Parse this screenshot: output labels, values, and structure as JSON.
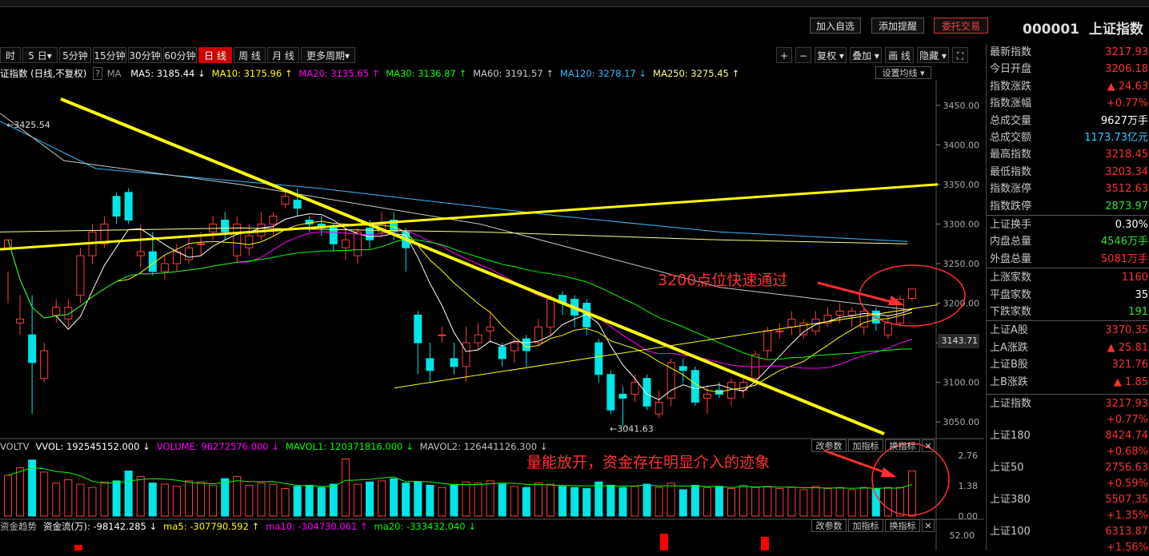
{
  "toolbar": {
    "buttons": [
      "加入自选",
      "添加提醒",
      "委托交易"
    ],
    "code": "000001",
    "name": "上证指数"
  },
  "periods": [
    "时",
    "5 日▾",
    "5分钟",
    "15分钟",
    "30分钟",
    "60分钟",
    "日 线",
    "周 线",
    "月 线",
    "更多周期▾"
  ],
  "active_period": "日 线",
  "tools": [
    "+",
    "−",
    "复权 ▾",
    "叠加 ▾",
    "画 线",
    "隐藏 ▾",
    "⛶"
  ],
  "ma_line": {
    "label": "证指数 (日线,不复权)",
    "help": "?",
    "ma": "MA",
    "items": [
      {
        "text": "MA5: 3185.44 ↓",
        "color": "#ffffff"
      },
      {
        "text": "MA10: 3175.96 ↑",
        "color": "#ffff00"
      },
      {
        "text": "MA20: 3135.65 ↑",
        "color": "#ff00ff"
      },
      {
        "text": "MA30: 3136.87 ↑",
        "color": "#00ff00"
      },
      {
        "text": "MA60: 3191.57 ↑",
        "color": "#c8c8c8"
      },
      {
        "text": "MA120: 3278.17 ↓",
        "color": "#33bbff"
      },
      {
        "text": "MA250: 3275.45 ↑",
        "color": "#ffff88"
      }
    ],
    "settings": "设置均线 ▾"
  },
  "vol_line": {
    "items": [
      {
        "text": "VOLTV",
        "color": "#c0c0c0"
      },
      {
        "text": "VVOL: 192545152.000 ↓",
        "color": "#ffffff"
      },
      {
        "text": "VOLUME: 96272576.000 ↓",
        "color": "#ff00ff"
      },
      {
        "text": "MAVOL1: 120371816.000 ↓",
        "color": "#00ff00"
      },
      {
        "text": "MAVOL2: 126441126.300 ↓",
        "color": "#c0c0c0"
      }
    ]
  },
  "flow_line": {
    "items": [
      {
        "text": "资金趋势",
        "color": "#c0c0c0"
      },
      {
        "text": "资金流(万): -98142.285 ↓",
        "color": "#ffffff"
      },
      {
        "text": "ma5: -307790.592 ↑",
        "color": "#ffff00"
      },
      {
        "text": "ma10: -304730.061 ↑",
        "color": "#ff00ff"
      },
      {
        "text": "ma20: -333432.040 ↓",
        "color": "#00ff00"
      }
    ]
  },
  "indicator_buttons": [
    "改参数",
    "加指标",
    "换指标",
    "✕"
  ],
  "side_rows": [
    {
      "k": "最新指数",
      "v": "3217.93",
      "c": "#ff3030"
    },
    {
      "k": "今日开盘",
      "v": "3206.18",
      "c": "#ff3030"
    },
    {
      "k": "指数涨跌",
      "v": "▲ 24.63",
      "c": "#ff3030"
    },
    {
      "k": "指数涨幅",
      "v": "+0.77%",
      "c": "#ff3030"
    },
    {
      "k": "总成交量",
      "v": "9627万手",
      "c": "#ffffff"
    },
    {
      "k": "总成交额",
      "v": "1173.73亿元",
      "c": "#33ccff"
    },
    {
      "k": "最高指数",
      "v": "3218.45",
      "c": "#ff3030"
    },
    {
      "k": "最低指数",
      "v": "3203.34",
      "c": "#ff3030"
    },
    {
      "k": "指数涨停",
      "v": "3512.63",
      "c": "#ff3030"
    },
    {
      "k": "指数跌停",
      "v": "2873.97",
      "c": "#33dd33"
    },
    {
      "k": "上证换手",
      "v": "0.30%",
      "c": "#ffffff"
    },
    {
      "k": "内盘总量",
      "v": "4546万手",
      "c": "#33dd33"
    },
    {
      "k": "外盘总量",
      "v": "5081万手",
      "c": "#ff3030"
    },
    {
      "k": "上涨家数",
      "v": "1160",
      "c": "#ff3030"
    },
    {
      "k": "平盘家数",
      "v": "35",
      "c": "#ffffff"
    },
    {
      "k": "下跌家数",
      "v": "191",
      "c": "#33dd33"
    },
    {
      "k": "上证A股",
      "v": "3370.35",
      "c": "#ff3030"
    },
    {
      "k": "上A涨跌",
      "v": "▲ 25.81",
      "c": "#ff3030"
    },
    {
      "k": "上证B股",
      "v": "321.76",
      "c": "#ff3030"
    },
    {
      "k": "上B涨跌",
      "v": "▲ 1.85",
      "c": "#ff3030"
    }
  ],
  "side_indices": [
    {
      "k": "上证指数",
      "v": "3217.93",
      "p": "+0.77%"
    },
    {
      "k": "上证180",
      "v": "8424.74",
      "p": "+0.68%"
    },
    {
      "k": "上证50",
      "v": "2756.63",
      "p": "+0.59%"
    },
    {
      "k": "上证380",
      "v": "5507.35",
      "p": "+1.35%"
    },
    {
      "k": "上证100",
      "v": "6313.87",
      "p": "+1.56%"
    }
  ],
  "annotations": {
    "a1": "3200点位快速通过",
    "a2": "量能放开，资金存在明显介入的迹象"
  },
  "current_price_tag": "3143.71",
  "chart_data": [
    {
      "type": "candlestick",
      "y_ticks": [
        "3450.00",
        "3400.00",
        "3350.00",
        "3300.00",
        "3250.00",
        "3200.00",
        "3150.00",
        "3100.00",
        "3050.00"
      ],
      "ylim": [
        3030,
        3470
      ],
      "high_label": "3425.54",
      "low_label": "3041.63",
      "candles": [
        [
          3270,
          3280,
          3240,
          3200
        ],
        [
          3175,
          3180,
          3210,
          3160
        ],
        [
          3160,
          3125,
          3210,
          3060
        ],
        [
          3105,
          3140,
          3150,
          3100
        ],
        [
          3185,
          3195,
          3205,
          3175
        ],
        [
          3180,
          3195,
          3205,
          3170
        ],
        [
          3210,
          3260,
          3270,
          3200
        ],
        [
          3260,
          3290,
          3300,
          3250
        ],
        [
          3275,
          3300,
          3310,
          3270
        ],
        [
          3335,
          3310,
          3340,
          3300
        ],
        [
          3340,
          3305,
          3345,
          3300
        ],
        [
          3260,
          3265,
          3300,
          3245
        ],
        [
          3265,
          3240,
          3290,
          3235
        ],
        [
          3240,
          3250,
          3260,
          3230
        ],
        [
          3250,
          3265,
          3275,
          3240
        ],
        [
          3255,
          3270,
          3285,
          3250
        ],
        [
          3275,
          3275,
          3290,
          3260
        ],
        [
          3290,
          3300,
          3310,
          3280
        ],
        [
          3305,
          3290,
          3315,
          3280
        ],
        [
          3260,
          3300,
          3310,
          3250
        ],
        [
          3270,
          3285,
          3300,
          3260
        ],
        [
          3285,
          3300,
          3315,
          3280
        ],
        [
          3300,
          3310,
          3315,
          3285
        ],
        [
          3325,
          3335,
          3345,
          3320
        ],
        [
          3330,
          3320,
          3345,
          3310
        ],
        [
          3305,
          3300,
          3310,
          3290
        ],
        [
          3300,
          3295,
          3310,
          3285
        ],
        [
          3295,
          3275,
          3300,
          3265
        ],
        [
          3270,
          3280,
          3295,
          3255
        ],
        [
          3260,
          3290,
          3295,
          3250
        ],
        [
          3295,
          3280,
          3305,
          3270
        ],
        [
          3290,
          3300,
          3315,
          3285
        ],
        [
          3305,
          3290,
          3315,
          3280
        ],
        [
          3290,
          3270,
          3295,
          3240
        ],
        [
          3185,
          3150,
          3190,
          3110
        ],
        [
          3130,
          3115,
          3150,
          3100
        ],
        [
          3160,
          3160,
          3170,
          3150
        ],
        [
          3130,
          3120,
          3150,
          3110
        ],
        [
          3120,
          3150,
          3170,
          3100
        ],
        [
          3150,
          3160,
          3175,
          3140
        ],
        [
          3165,
          3170,
          3190,
          3150
        ],
        [
          3145,
          3130,
          3150,
          3120
        ],
        [
          3140,
          3150,
          3155,
          3125
        ],
        [
          3155,
          3140,
          3160,
          3120
        ],
        [
          3150,
          3170,
          3180,
          3145
        ],
        [
          3170,
          3205,
          3210,
          3160
        ],
        [
          3210,
          3200,
          3215,
          3185
        ],
        [
          3205,
          3185,
          3210,
          3170
        ],
        [
          3200,
          3170,
          3205,
          3160
        ],
        [
          3150,
          3110,
          3155,
          3100
        ],
        [
          3110,
          3065,
          3115,
          3060
        ],
        [
          3085,
          3080,
          3095,
          3045
        ],
        [
          3085,
          3100,
          3110,
          3075
        ],
        [
          3105,
          3070,
          3110,
          3065
        ],
        [
          3060,
          3075,
          3090,
          3055
        ],
        [
          3080,
          3125,
          3130,
          3070
        ],
        [
          3120,
          3115,
          3130,
          3100
        ],
        [
          3115,
          3075,
          3120,
          3070
        ],
        [
          3080,
          3085,
          3095,
          3060
        ],
        [
          3090,
          3085,
          3100,
          3080
        ],
        [
          3080,
          3100,
          3105,
          3070
        ],
        [
          3090,
          3100,
          3110,
          3080
        ],
        [
          3105,
          3135,
          3140,
          3095
        ],
        [
          3140,
          3165,
          3170,
          3130
        ],
        [
          3165,
          3165,
          3175,
          3155
        ],
        [
          3170,
          3180,
          3190,
          3160
        ],
        [
          3160,
          3175,
          3180,
          3155
        ],
        [
          3165,
          3180,
          3190,
          3160
        ],
        [
          3175,
          3185,
          3195,
          3170
        ],
        [
          3185,
          3190,
          3200,
          3175
        ],
        [
          3185,
          3190,
          3195,
          3170
        ],
        [
          3170,
          3190,
          3195,
          3160
        ],
        [
          3190,
          3175,
          3195,
          3165
        ],
        [
          3160,
          3175,
          3185,
          3155
        ],
        [
          3175,
          3205,
          3210,
          3170
        ],
        [
          3206,
          3218,
          3218,
          3203
        ]
      ]
    },
    {
      "type": "bar",
      "y_ticks": [
        "2.76",
        "1.38",
        "0.00"
      ],
      "ylim": [
        0,
        2.76
      ],
      "values": [
        1.85,
        2.2,
        2.55,
        2.0,
        1.5,
        1.65,
        1.45,
        1.3,
        1.55,
        1.6,
        2.05,
        1.8,
        1.5,
        1.45,
        1.35,
        1.6,
        1.55,
        1.4,
        1.7,
        1.8,
        1.4,
        1.5,
        1.45,
        1.25,
        1.35,
        1.4,
        1.3,
        1.45,
        2.6,
        1.45,
        1.55,
        1.6,
        1.7,
        1.5,
        1.55,
        1.4,
        1.3,
        1.4,
        1.55,
        1.5,
        1.6,
        1.45,
        1.35,
        1.3,
        1.5,
        1.45,
        1.35,
        1.3,
        1.25,
        1.55,
        1.4,
        1.3,
        1.35,
        1.45,
        1.3,
        1.5,
        1.2,
        1.4,
        1.3,
        1.35,
        1.25,
        1.4,
        1.3,
        1.35,
        1.25,
        1.3,
        1.2,
        1.35,
        1.25,
        1.3,
        1.2,
        1.3,
        1.25,
        1.3,
        1.3,
        2.05
      ]
    }
  ]
}
